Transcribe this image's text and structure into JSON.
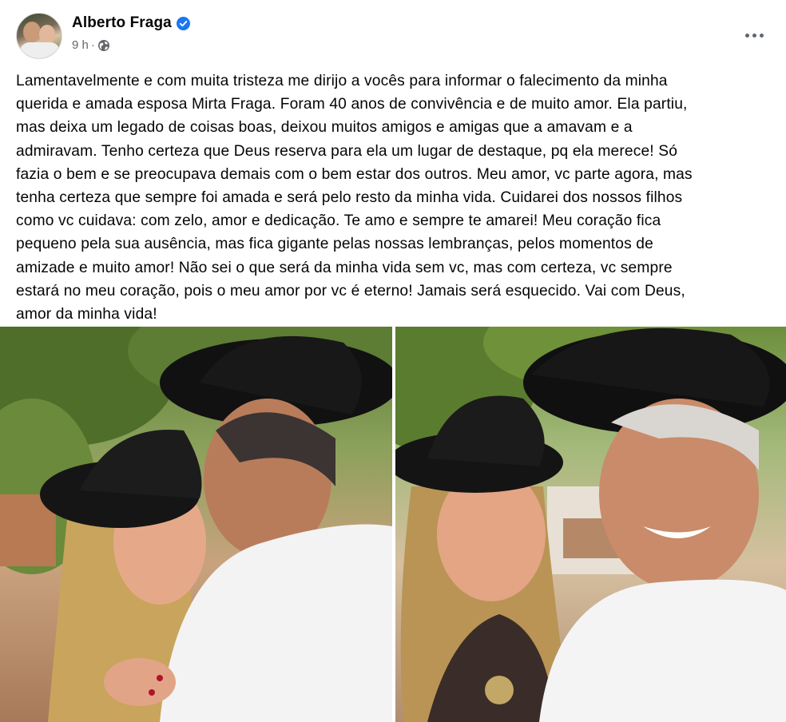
{
  "post": {
    "author": "Alberto Fraga",
    "timestamp": "9 h",
    "separator": "·",
    "privacy_icon": "globe-icon",
    "verified_icon": "verified-badge-icon",
    "more_icon": "more-options-icon",
    "text": "Lamentavelmente e com muita tristeza me dirijo a vocês para informar o falecimento da minha\nquerida e amada esposa Mirta Fraga. Foram 40 anos de convivência e de muito amor. Ela partiu,\nmas deixa um legado de coisas boas, deixou muitos amigos e amigas que a amavam e a\nadmiravam. Tenho certeza que Deus reserva para ela um lugar de destaque, pq ela merece! Só\nfazia o bem e se preocupava demais com o bem estar dos outros. Meu amor, vc parte agora, mas\ntenha certeza que sempre foi amada e será pelo resto da minha vida. Cuidarei dos nossos filhos\ncomo vc cuidava: com zelo, amor e dedicação. Te amo e sempre te amarei! Meu coração fica\npequeno pela sua ausência, mas fica gigante pelas nossas lembranças, pelos momentos de\namizade e muito amor! Não sei o que será da minha vida sem vc, mas com certeza, vc sempre\nestará no meu coração, pois o meu amor por vc é eterno! Jamais será esquecido. Vai com Deus,\namor da minha vida!"
  },
  "colors": {
    "primary_text": "#050505",
    "secondary_text": "#65676b",
    "verified_blue": "#1877f2",
    "background": "#ffffff"
  }
}
